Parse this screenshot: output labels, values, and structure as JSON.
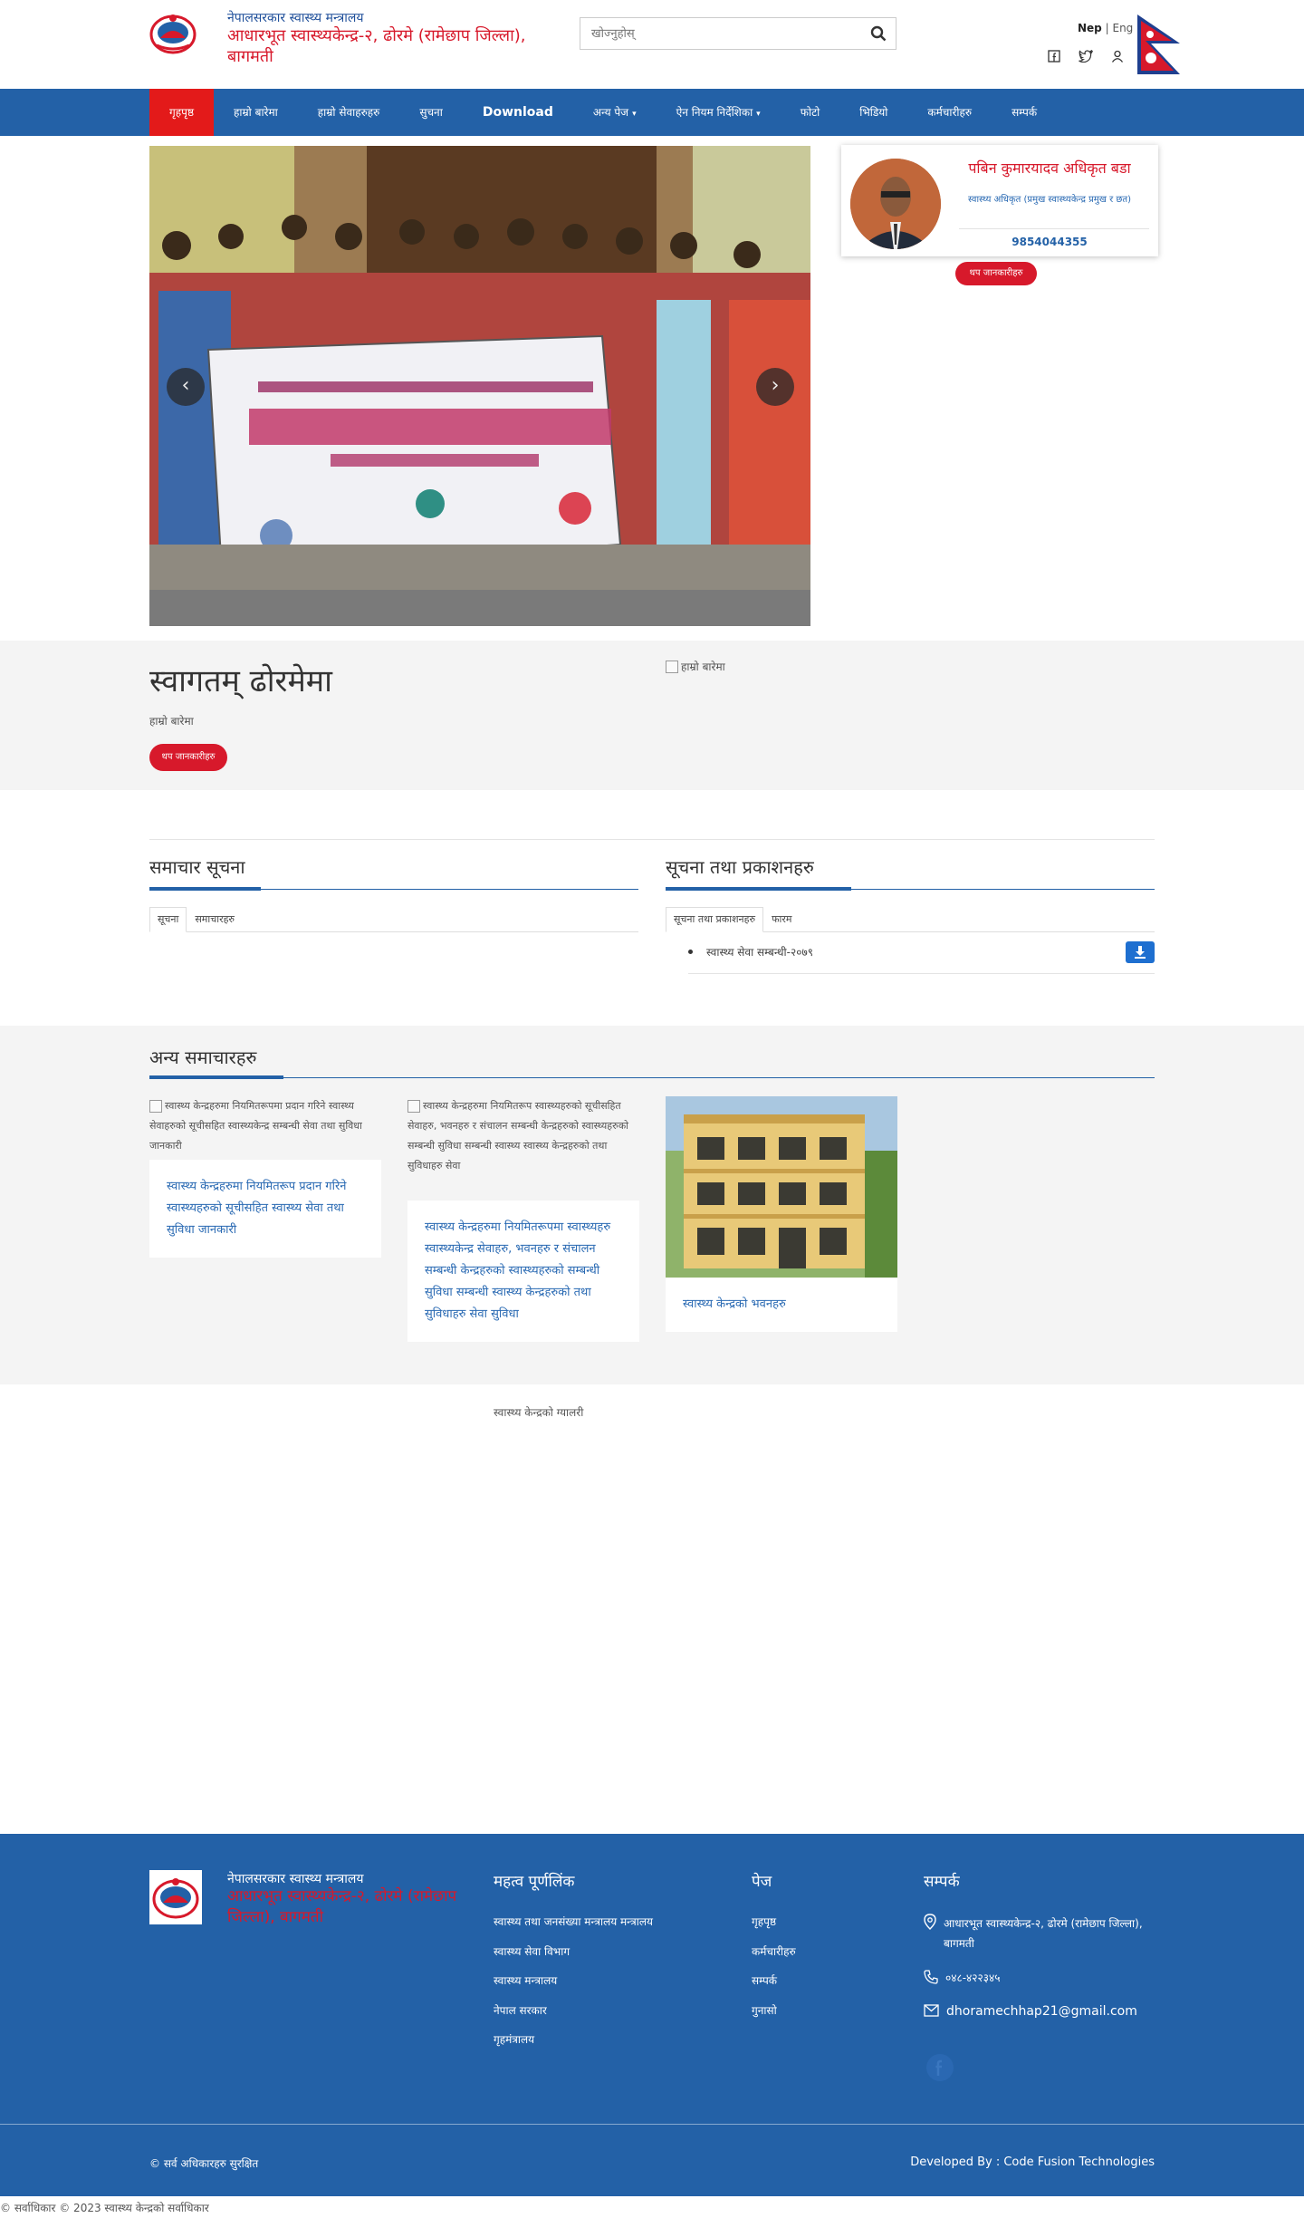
{
  "header": {
    "gov_line1": "नेपालसरकार स्वास्थ्य मन्त्रालय",
    "gov_line2": "आधारभूत स्वास्थ्यकेन्द्र-२, ढोरमे (रामेछाप जिल्ला), बागमती",
    "search_placeholder": "खोज्नुहोस्",
    "lang_nep": "Nep",
    "lang_sep": "|",
    "lang_eng": "Eng"
  },
  "nav": {
    "items": [
      {
        "label": "गृहपृष्ठ",
        "active": true
      },
      {
        "label": "हाम्रो बारेमा"
      },
      {
        "label": "हाम्रो सेवाहरुहरु"
      },
      {
        "label": "सुचना"
      },
      {
        "label": "Download",
        "bold": true
      },
      {
        "label": "अन्य पेज",
        "caret": true
      },
      {
        "label": "ऐन नियम निर्देशिका",
        "caret": true
      },
      {
        "label": "फोटो"
      },
      {
        "label": "भिडियो"
      },
      {
        "label": "कर्मचारीहरु"
      },
      {
        "label": "सम्पर्क"
      }
    ]
  },
  "slider": {
    "prev": "‹",
    "next": "›"
  },
  "profile": {
    "name": "पबिन कुमारयादव अधिकृत बडा",
    "role": "स्वास्थ्य अधिकृत (प्रमुख स्वास्थ्यकेन्द्र प्रमुख र छत)",
    "phone": "9854044355",
    "more": "थप जानकारीहरु"
  },
  "intro": {
    "title": "स्वागतम् ढोरमेमा",
    "subtitle": "हाम्रो बारेमा",
    "more_button": "थप जानकारीहरु",
    "image_alt": "हाम्रो बारेमा"
  },
  "news": {
    "title": "समाचार सूचना",
    "tabs": [
      "सूचना",
      "समाचारहरु"
    ]
  },
  "downloads": {
    "title": "सूचना तथा प्रकाशनहरु",
    "tabs": [
      "सूचना तथा प्रकाशनहरु",
      "फारम"
    ],
    "items": [
      "स्वास्थ्य सेवा सम्बन्धी-२०७९"
    ]
  },
  "other_news": {
    "title": "अन्य समाचारहरु",
    "cards": [
      {
        "alt": "स्वास्थ्य केन्द्रहरुमा नियमितरूपमा प्रदान गरिने स्वास्थ्य सेवाहरुको सूचीसहित स्वास्थ्यकेन्द्र सम्बन्धी सेवा तथा सुविधा जानकारी",
        "link": "स्वास्थ्य केन्द्रहरुमा नियमितरूप प्रदान गरिने स्वास्थ्यहरुको सूचीसहित स्वास्थ्य सेवा तथा सुविधा जानकारी"
      },
      {
        "alt": "स्वास्थ्य केन्द्रहरुमा नियमितरूप स्वास्थ्यहरुको सूचीसहित सेवाहरु, भवनहरु र संचालन सम्बन्धी केन्द्रहरुको स्वास्थ्यहरुको सम्बन्धी सुविधा सम्बन्धी स्वास्थ्य स्वास्थ्य केन्द्रहरुको तथा सुविधाहरु सेवा",
        "link": "स्वास्थ्य केन्द्रहरुमा नियमितरूपमा स्वास्थ्यहरु स्वास्थ्यकेन्द्र सेवाहरु, भवनहरु र संचालन सम्बन्धी केन्द्रहरुको स्वास्थ्यहरुको सम्बन्धी सुविधा सम्बन्धी स्वास्थ्य केन्द्रहरुको तथा सुविधाहरु सेवा सुविधा"
      },
      {
        "link": "स्वास्थ्य केन्द्रको भवनहरु"
      }
    ],
    "gallery_caption": "स्वास्थ्य केन्द्रको ग्यालरी"
  },
  "footer": {
    "gov_line1": "नेपालसरकार स्वास्थ्य मन्त्रालय",
    "gov_line2": "आधारभूत स्वास्थ्यकेन्द्र-२, ढोरमे (रामेछाप जिल्ला), बागमती",
    "links_title": "महत्व पूर्णलिंक",
    "links": [
      "स्वास्थ्य तथा जनसंख्या मन्त्रालय मन्त्रालय",
      "स्वास्थ्य सेवा विभाग",
      "स्वास्थ्य मन्त्रालय",
      "नेपाल सरकार",
      "गृहमंत्रालय"
    ],
    "pages_title": "पेज",
    "pages": [
      "गृहपृष्ठ",
      "कर्मचारीहरु",
      "सम्पर्क",
      "गुनासो"
    ],
    "contact_title": "सम्पर्क",
    "address": "आधारभूत स्वास्थ्यकेन्द्र-२, ढोरमे (रामेछाप जिल्ला), बागमती",
    "phone": "०४८-४२२३४५",
    "email": "dhoramechhap21@gmail.com",
    "copyright": "© सर्व अधिकारहरु सुरक्षित",
    "developer": "Developed By : Code Fusion Technologies"
  },
  "bottom_copyright": "© सर्वाधिकार © 2023 स्वास्थ्य केन्द्रको सर्वाधिकार",
  "colors": {
    "nav_blue": "#2361a7",
    "brand_red": "#d7192b",
    "download_blue": "#1e6fd0"
  }
}
